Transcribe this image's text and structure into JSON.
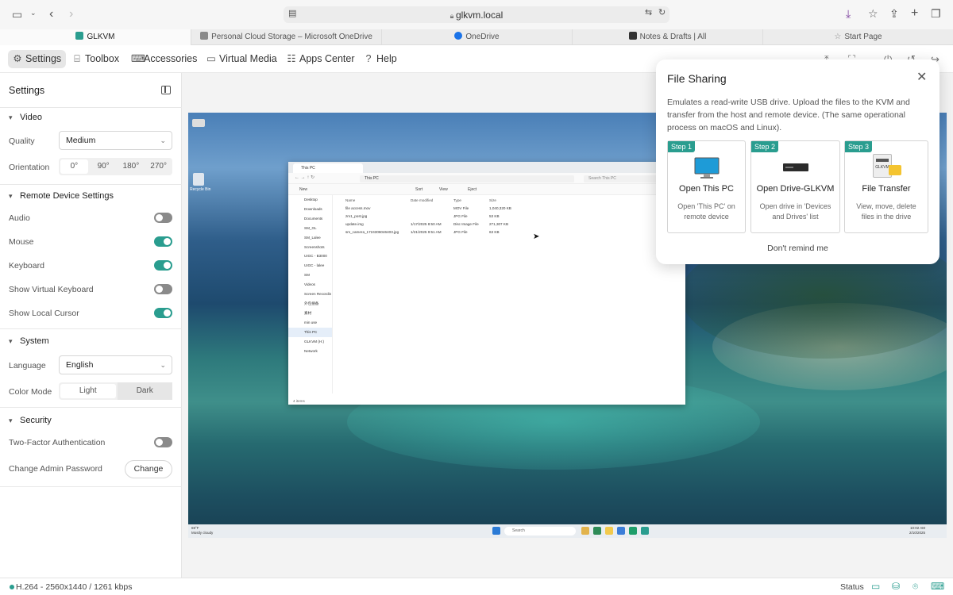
{
  "browser": {
    "url": "glkvm.local",
    "tabs": [
      {
        "label": "GLKVM",
        "color": "#2a9d8f"
      },
      {
        "label": "Personal Cloud Storage – Microsoft OneDrive",
        "color": "#8a8a8a"
      },
      {
        "label": "OneDrive",
        "color": "#1a73e8"
      },
      {
        "label": "Notes & Drafts | All",
        "color": "#333333"
      },
      {
        "label": "Start Page",
        "color": "#888888"
      }
    ],
    "icons": [
      "sidebar-toggle-icon",
      "chevron-down-icon",
      "back-icon",
      "forward-icon",
      "download-icon",
      "star-icon",
      "share-icon",
      "new-tab-icon",
      "tabs-overview-icon"
    ]
  },
  "nav": {
    "items": [
      {
        "label": "Settings",
        "icon": "gear-icon",
        "active": true
      },
      {
        "label": "Toolbox",
        "icon": "toolbox-icon"
      },
      {
        "label": "Accessories",
        "icon": "accessories-icon"
      },
      {
        "label": "Virtual Media",
        "icon": "media-icon"
      },
      {
        "label": "Apps Center",
        "icon": "apps-icon"
      },
      {
        "label": "Help",
        "icon": "help-icon"
      }
    ]
  },
  "sidebar": {
    "title": "Settings",
    "video": {
      "heading": "Video",
      "quality_label": "Quality",
      "quality_value": "Medium",
      "orientation_label": "Orientation",
      "orientations": [
        "0°",
        "90°",
        "180°",
        "270°"
      ]
    },
    "remote": {
      "heading": "Remote Device Settings",
      "audio": "Audio",
      "mouse": "Mouse",
      "keyboard": "Keyboard",
      "virtual_keyboard": "Show Virtual Keyboard",
      "local_cursor": "Show Local Cursor",
      "states": {
        "audio": false,
        "mouse": true,
        "keyboard": true,
        "virtual_keyboard": false,
        "local_cursor": true
      }
    },
    "system": {
      "heading": "System",
      "language_label": "Language",
      "language_value": "English",
      "color_mode_label": "Color Mode",
      "light": "Light",
      "dark": "Dark",
      "selected_mode": "Dark"
    },
    "security": {
      "heading": "Security",
      "two_factor": "Two-Factor Authentication",
      "two_factor_on": false,
      "change_password": "Change Admin Password",
      "change_button": "Change"
    }
  },
  "file_sharing": {
    "title": "File Sharing",
    "description": "Emulates a read-write USB drive. Upload the files to the KVM and transfer from the host and remote device. (The same operational process on macOS and Linux).",
    "steps": [
      {
        "step": "Step 1",
        "title": "Open This PC",
        "desc": "Open 'This PC' on remote device"
      },
      {
        "step": "Step 2",
        "title": "Open Drive-GLKVM",
        "desc": "Open drive in 'Devices and Drives' list"
      },
      {
        "step": "Step 3",
        "title": "File Transfer",
        "desc": "View, move, delete files in the drive"
      }
    ],
    "remind": "Don't remind me",
    "drive_label": "GLKVM"
  },
  "remote_desktop": {
    "window_title": "This PC",
    "address": "This PC",
    "search_placeholder": "Search This PC",
    "toolbar": [
      "New",
      "Sort",
      "View",
      "Eject"
    ],
    "nav_items": [
      "Desktop",
      "Downloads",
      "Documents",
      "SM_GL",
      "SM_Lalee",
      "Screenshots",
      "UIGC - B3000",
      "UIGC - lalee",
      "SM",
      "Videos",
      "Screen Recordin",
      "外包搜备",
      "素材",
      "min use",
      "This PC",
      "GLKVM (H:)",
      "Network"
    ],
    "columns": [
      "Name",
      "Date modified",
      "Type",
      "Size"
    ],
    "files": [
      {
        "name": "file access.mov",
        "date": "",
        "type": "MOV File",
        "size": "1,040,320 KB"
      },
      {
        "name": "zm1_post.jpg",
        "date": "",
        "type": "JPG File",
        "size": "53 KB"
      },
      {
        "name": "update.img",
        "date": "1/17/2025 8:50 AM",
        "type": "Disc Image File",
        "size": "271,307 KB"
      },
      {
        "name": "sm_camera_1724306046403.jpg",
        "date": "1/21/2025 9:51 AM",
        "type": "JPG File",
        "size": "63 KB"
      }
    ],
    "status": "4 items",
    "desktop_icons": [
      "Recycle Bin"
    ],
    "taskbar_search": "Search",
    "weather_temp": "69°F",
    "weather_desc": "Mostly cloudy",
    "clock_time": "10:02 AM",
    "clock_date": "2/10/2025"
  },
  "status": {
    "stream": "H.264 - 2560x1440 / 1261 kbps",
    "label": "Status",
    "icons": [
      "screen-icon",
      "hdd-icon",
      "mouse-icon",
      "keyboard-icon",
      "mute-icon"
    ]
  },
  "colors": {
    "accent": "#2a9d8f"
  }
}
